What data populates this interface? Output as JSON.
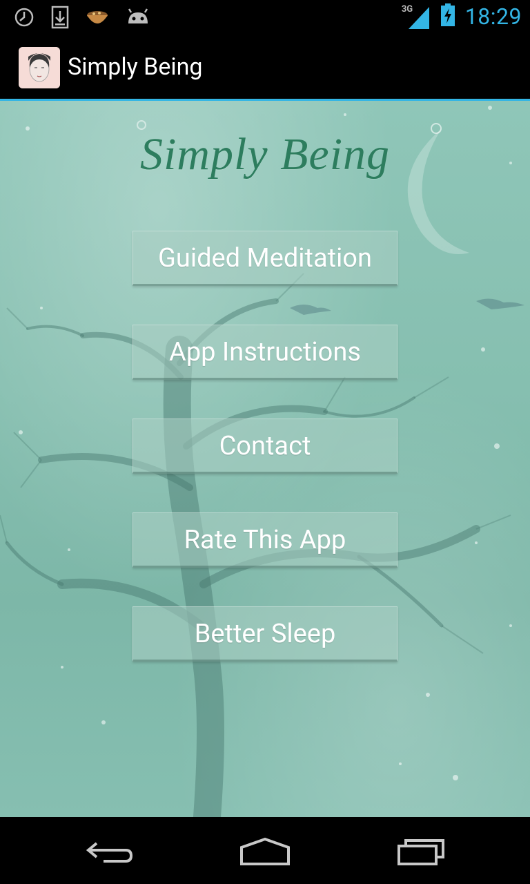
{
  "status_bar": {
    "time": "18:29",
    "network": "3G",
    "icons": [
      "clock-icon",
      "download-icon",
      "bowl-icon",
      "android-icon",
      "signal-icon",
      "battery-icon"
    ]
  },
  "action_bar": {
    "title": "Simply Being"
  },
  "content": {
    "logo": "Simply Being",
    "buttons": [
      {
        "label": "Guided Meditation"
      },
      {
        "label": "App Instructions"
      },
      {
        "label": "Contact"
      },
      {
        "label": "Rate This App"
      },
      {
        "label": "Better Sleep"
      }
    ]
  },
  "nav_bar": {
    "icons": [
      "back-icon",
      "home-icon",
      "recents-icon"
    ]
  },
  "colors": {
    "accent": "#33b5e5",
    "background": "#86bfb0",
    "logo": "#2d7d5e"
  }
}
